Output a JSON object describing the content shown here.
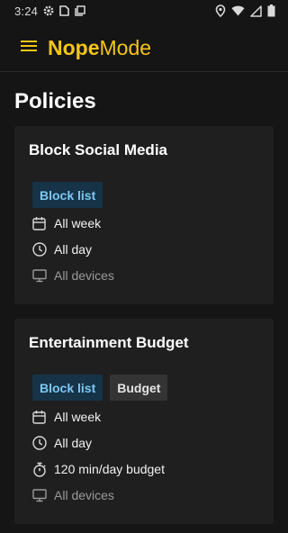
{
  "status_bar": {
    "time": "3:24",
    "icons": [
      "settings-gear-icon",
      "sim-card-icon",
      "screenshot-icon",
      "location-pin-icon",
      "wifi-icon",
      "signal-icon",
      "battery-icon"
    ]
  },
  "app_bar": {
    "menu_icon": "hamburger-menu-icon",
    "brand_strong": "Nope",
    "brand_light": "Mode",
    "brand_color": "#f5c518"
  },
  "page": {
    "title": "Policies"
  },
  "policies": [
    {
      "title": "Block Social Media",
      "chips": [
        "Block list"
      ],
      "rows": [
        {
          "icon": "calendar-icon",
          "text": "All week"
        },
        {
          "icon": "clock-icon",
          "text": "All day"
        },
        {
          "icon": "monitor-icon",
          "text": "All devices"
        }
      ]
    },
    {
      "title": "Entertainment Budget",
      "chips": [
        "Block list",
        "Budget"
      ],
      "rows": [
        {
          "icon": "calendar-icon",
          "text": "All week"
        },
        {
          "icon": "clock-icon",
          "text": "All day"
        },
        {
          "icon": "stopwatch-icon",
          "text": "120 min/day budget"
        },
        {
          "icon": "monitor-icon",
          "text": "All devices"
        }
      ]
    }
  ],
  "colors": {
    "background": "#151515",
    "card": "#1f1f1f",
    "block_chip_bg": "#173347",
    "block_chip_text": "#7cc8f2",
    "budget_chip_bg": "#343434",
    "muted_text": "#9a9a9a"
  }
}
